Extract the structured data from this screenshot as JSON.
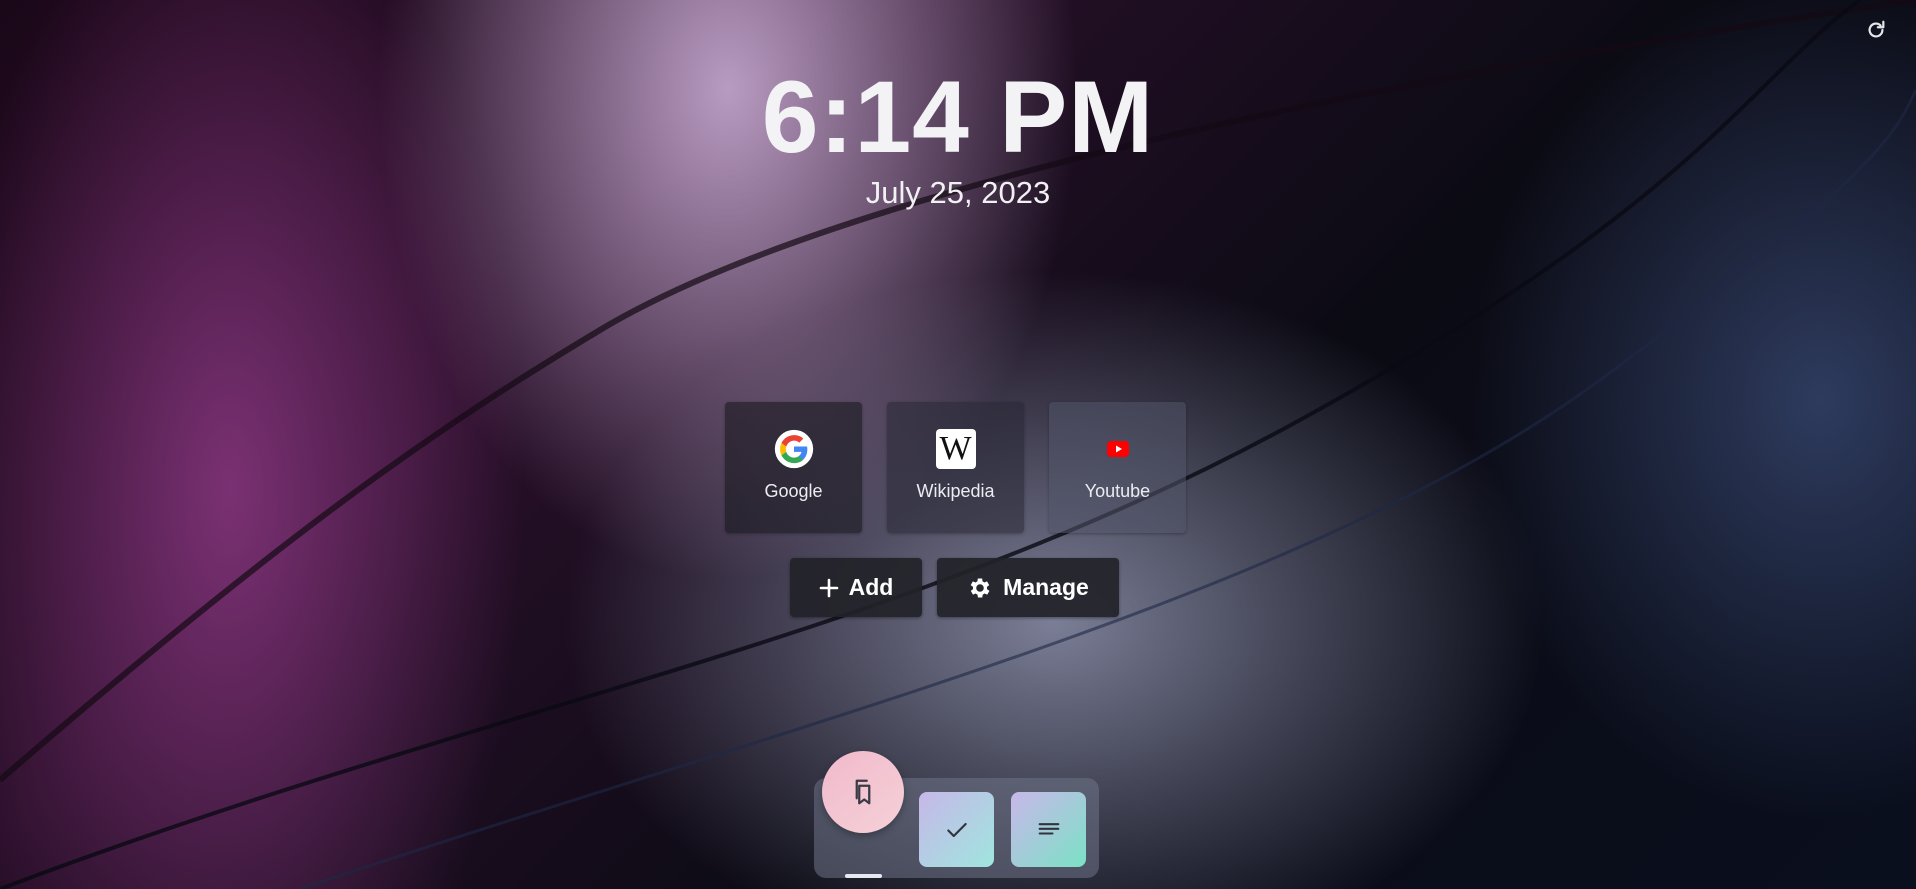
{
  "clock": {
    "time": "6:14 PM",
    "date": "July 25, 2023"
  },
  "shortcuts": [
    {
      "label": "Google",
      "icon": "google-icon"
    },
    {
      "label": "Wikipedia",
      "icon": "wikipedia-icon",
      "icon_text": "W"
    },
    {
      "label": "Youtube",
      "icon": "youtube-icon"
    }
  ],
  "actions": {
    "add_label": "Add",
    "manage_label": "Manage"
  },
  "dock": {
    "items": [
      "bookmarks-icon",
      "checkmark-icon",
      "notes-icon"
    ],
    "active_index": 0
  },
  "colors": {
    "text": "#f3f3f5",
    "youtube_red": "#ff0000",
    "google_blue": "#4285f4"
  }
}
